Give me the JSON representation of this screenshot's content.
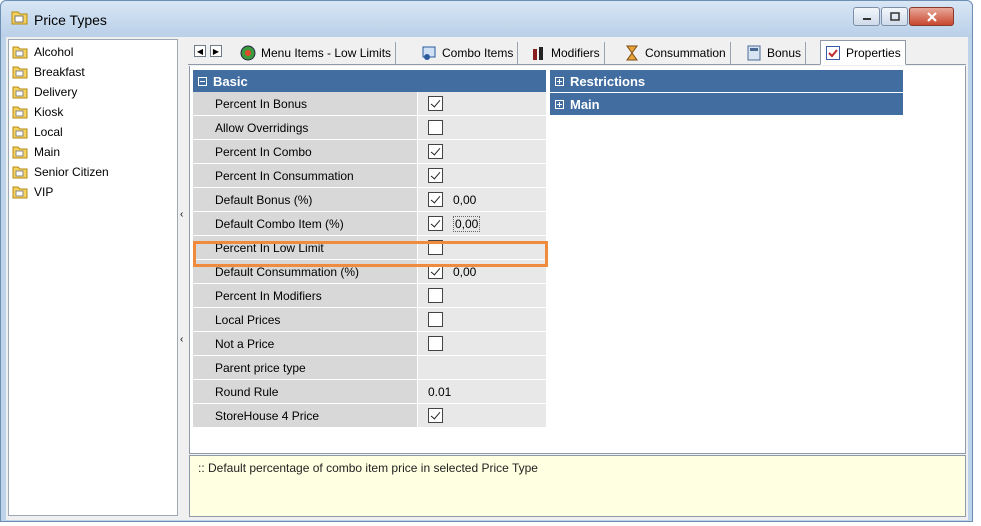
{
  "window": {
    "title": "Price Types"
  },
  "tree": {
    "items": [
      {
        "label": "Alcohol"
      },
      {
        "label": "Breakfast"
      },
      {
        "label": "Delivery"
      },
      {
        "label": "Kiosk"
      },
      {
        "label": "Local"
      },
      {
        "label": "Main"
      },
      {
        "label": "Senior Citizen"
      },
      {
        "label": "VIP"
      }
    ]
  },
  "tabs": [
    {
      "label": "Menu Items - Low Limits"
    },
    {
      "label": "Combo Items"
    },
    {
      "label": "Modifiers"
    },
    {
      "label": "Consummation"
    },
    {
      "label": "Bonus"
    },
    {
      "label": "Properties"
    }
  ],
  "groups": {
    "basic": "Basic",
    "restrictions": "Restrictions",
    "main": "Main"
  },
  "properties": [
    {
      "name": "Percent In Bonus",
      "checked": true,
      "value": ""
    },
    {
      "name": "Allow Overridings",
      "checked": false,
      "value": ""
    },
    {
      "name": "Percent In Combo",
      "checked": true,
      "value": ""
    },
    {
      "name": "Percent In Consummation",
      "checked": true,
      "value": ""
    },
    {
      "name": "Default Bonus (%)",
      "checked": true,
      "value": "0,00"
    },
    {
      "name": "Default Combo Item (%)",
      "checked": true,
      "value": "0,00"
    },
    {
      "name": "Percent In Low Limit",
      "checked": false,
      "value": ""
    },
    {
      "name": "Default Consummation (%)",
      "checked": true,
      "value": "0,00"
    },
    {
      "name": "Percent In Modifiers",
      "checked": false,
      "value": ""
    },
    {
      "name": "Local Prices",
      "checked": false,
      "value": ""
    },
    {
      "name": "Not a Price",
      "checked": false,
      "value": ""
    },
    {
      "name": "Parent price type",
      "checked": null,
      "value": ""
    },
    {
      "name": "Round Rule",
      "checked": null,
      "value": "0.01"
    },
    {
      "name": "StoreHouse 4 Price",
      "checked": true,
      "value": ""
    }
  ],
  "description": ":: Default percentage of combo item price in selected Price Type",
  "colors": {
    "group_header": "#416da1",
    "highlight": "#f08a3c",
    "desc_bg": "#ffffe1"
  }
}
